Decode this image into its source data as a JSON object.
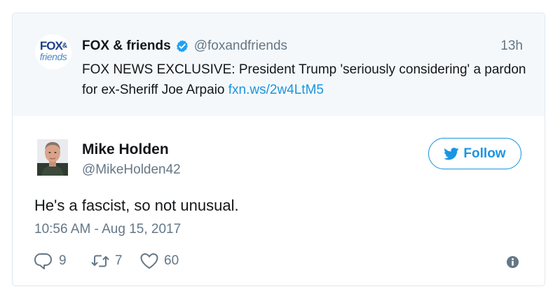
{
  "quoted_tweet": {
    "logo": {
      "line1": "FOX",
      "amp": "&",
      "line2": "friends"
    },
    "name": "FOX & friends",
    "handle": "@foxandfriends",
    "time": "13h",
    "text": "FOX NEWS EXCLUSIVE: President Trump 'seriously considering' a pardon for ex-Sheriff Joe Arpaio ",
    "link": "fxn.ws/2w4LtM5",
    "verified": true
  },
  "tweet": {
    "author_name": "Mike Holden",
    "author_handle": "@MikeHolden42",
    "follow_label": "Follow",
    "text": "He's a fascist, so not unusual.",
    "timestamp": "10:56 AM - Aug 15, 2017"
  },
  "actions": {
    "reply_count": "9",
    "retweet_count": "7",
    "like_count": "60"
  },
  "icons": {
    "verified": "verified-badge-icon",
    "bird": "twitter-bird-icon",
    "reply": "reply-icon",
    "retweet": "retweet-icon",
    "like": "heart-icon",
    "info": "info-icon"
  },
  "colors": {
    "accent": "#1b95e0",
    "muted": "#657786",
    "text": "#14171a",
    "quoted_bg": "#f5f8fa",
    "border": "#e1e8ed"
  }
}
